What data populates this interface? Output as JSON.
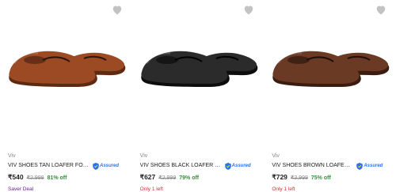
{
  "products": [
    {
      "brand": "Viv",
      "title": "VIV SHOES TAN LOAFER FOR MEN",
      "assured_label": "Assured",
      "price": "₹540",
      "mrp": "₹2,999",
      "discount": "81% off",
      "tag": "Saver Deal",
      "shoe_color": "#9c4a24",
      "shoe_dark": "#5e2a12"
    },
    {
      "brand": "Viv",
      "title": "VIV SHOES BLACK LOAFER FOR MEN",
      "assured_label": "Assured",
      "price": "₹627",
      "mrp": "₹2,999",
      "discount": "79% off",
      "tag": "Only 1 left",
      "shoe_color": "#2b2b2b",
      "shoe_dark": "#0d0d0d"
    },
    {
      "brand": "Viv",
      "title": "VIV SHOES BROWN LOAFER FOR MEN",
      "assured_label": "Assured",
      "price": "₹729",
      "mrp": "₹2,999",
      "discount": "75% off",
      "tag": "Only 1 left",
      "shoe_color": "#6b3a24",
      "shoe_dark": "#3a1d10"
    }
  ],
  "icons": {
    "wishlist": "heart-icon",
    "assured": "assured-shield-icon"
  }
}
